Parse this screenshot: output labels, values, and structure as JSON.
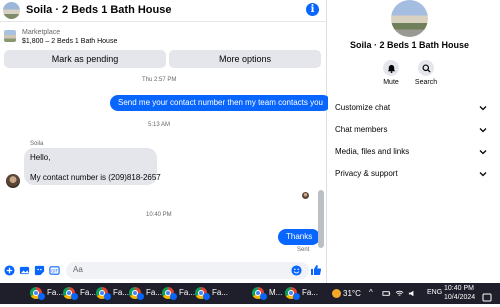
{
  "header": {
    "title": "Soila · 2 Beds 1 Bath House"
  },
  "listing": {
    "source": "Marketplace",
    "description": "$1,800 – 2 Beds 1 Bath House"
  },
  "actions": {
    "pending": "Mark as pending",
    "more": "More options"
  },
  "messages": {
    "ts1": "Thu 2:57 PM",
    "out1": "Send me your contact number then my team contacts you",
    "ts2": "5:13 AM",
    "sender": "Soila",
    "in1_line1": "Hello,",
    "in1_line2": "My contact number is (209)818-2657",
    "ts3": "10:40 PM",
    "out2": "Thanks",
    "status": "Sent"
  },
  "composer": {
    "placeholder": "Aa"
  },
  "details": {
    "title": "Soila · 2 Beds 1 Bath House",
    "mute": "Mute",
    "search": "Search",
    "sections": [
      "Customize chat",
      "Chat members",
      "Media, files and links",
      "Privacy & support"
    ]
  },
  "taskbar": {
    "apps": [
      "Fa...",
      "Fa...",
      "Fa...",
      "Fa...",
      "Fa...",
      "Fa...",
      "M...",
      "Fa..."
    ],
    "temperature": "31°C",
    "language": "ENG",
    "time": "10:40 PM",
    "date": "10/4/2024"
  },
  "colors": {
    "accent": "#0866ff",
    "bubble_in": "#e4e6eb",
    "taskbar": "#1f1f2b"
  },
  "icons": [
    "info-icon",
    "bell-icon",
    "search-icon",
    "chevron-down-icon",
    "plus-icon",
    "image-icon",
    "sticker-icon",
    "gif-icon",
    "emoji-icon",
    "thumbs-up-icon"
  ]
}
